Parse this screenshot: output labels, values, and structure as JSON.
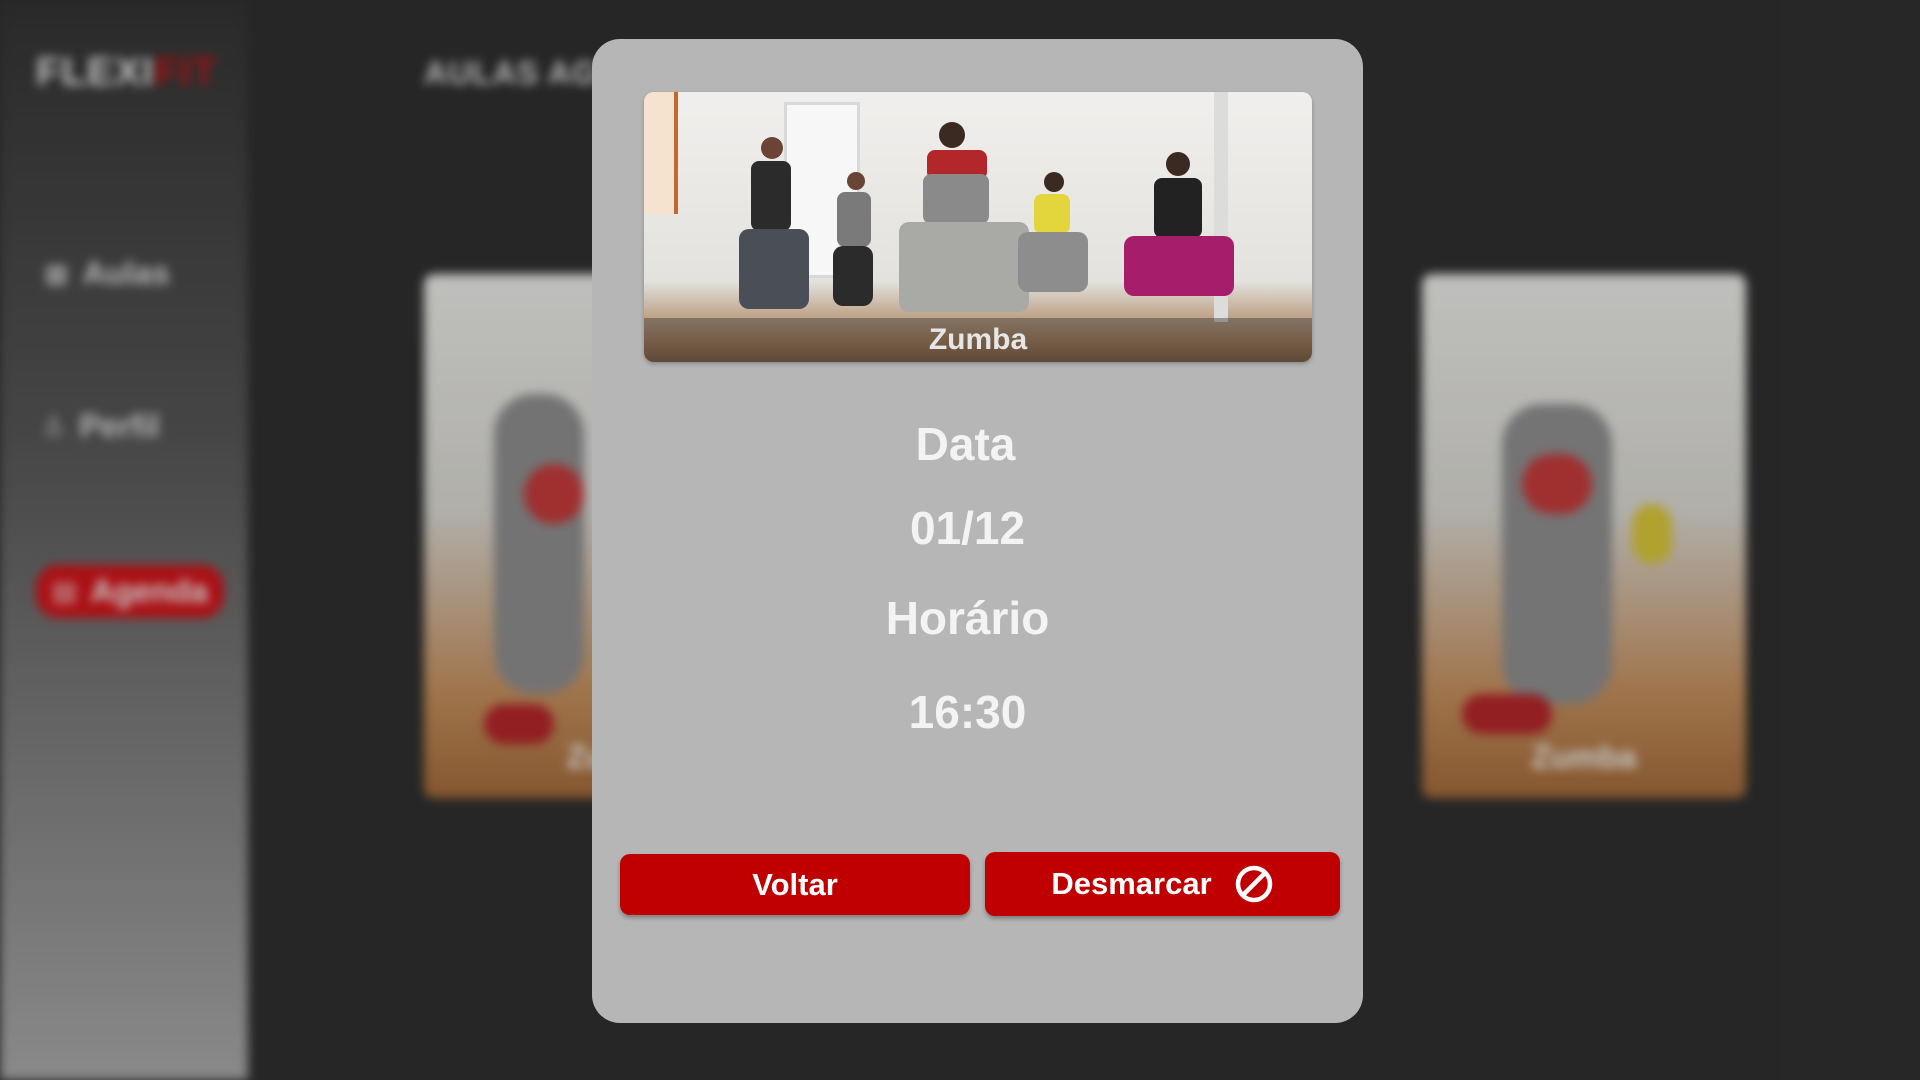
{
  "app": {
    "brand_part1": "FLEXI",
    "brand_part2": "FIT",
    "page_title": "AULAS AG"
  },
  "sidebar": {
    "items": [
      {
        "label": "Aulas",
        "icon": "grid-icon"
      },
      {
        "label": "Perfil",
        "icon": "user-icon"
      },
      {
        "label": "Agenda",
        "icon": "calendar-icon",
        "active": true
      }
    ]
  },
  "background_cards": [
    {
      "label": "Zu"
    },
    {
      "label": "Zumba"
    }
  ],
  "modal": {
    "class_name": "Zumba",
    "date_label": "Data",
    "date_value": "01/12",
    "time_label": "Horário",
    "time_value": "16:30",
    "back_button": "Voltar",
    "cancel_button": "Desmarcar",
    "cancel_icon": "ban-icon"
  },
  "colors": {
    "accent_red": "#c00000",
    "brand_red": "#c0151b",
    "modal_bg": "#b6b6b6",
    "app_bg": "#2f2f2f"
  }
}
